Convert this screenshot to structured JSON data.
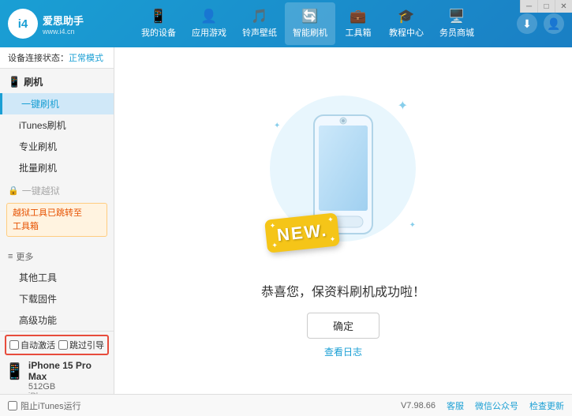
{
  "app": {
    "title": "爱思助手",
    "subtitle": "www.i4.cn"
  },
  "window_controls": {
    "minimize": "─",
    "maximize": "□",
    "close": "✕"
  },
  "nav": {
    "tabs": [
      {
        "id": "my-device",
        "label": "我的设备",
        "icon": "📱"
      },
      {
        "id": "apps-games",
        "label": "应用游戏",
        "icon": "👤"
      },
      {
        "id": "ringtones",
        "label": "铃声壁纸",
        "icon": "🎵"
      },
      {
        "id": "smart-flash",
        "label": "智能刷机",
        "icon": "🔄",
        "active": true
      },
      {
        "id": "toolbox",
        "label": "工具箱",
        "icon": "💼"
      },
      {
        "id": "tutorials",
        "label": "教程中心",
        "icon": "🎓"
      },
      {
        "id": "service",
        "label": "务员商城",
        "icon": "🖥️"
      }
    ]
  },
  "header_right": {
    "download_icon": "⬇",
    "user_icon": "👤"
  },
  "sidebar": {
    "status_label": "设备连接状态：",
    "status_value": "正常模式",
    "flash_section": {
      "label": "刷机",
      "icon": "📱"
    },
    "items": [
      {
        "id": "one-key-flash",
        "label": "一键刷机",
        "active": true
      },
      {
        "id": "itunes-flash",
        "label": "iTunes刷机",
        "active": false
      },
      {
        "id": "pro-flash",
        "label": "专业刷机",
        "active": false
      },
      {
        "id": "batch-flash",
        "label": "批量刷机",
        "active": false
      }
    ],
    "disabled_item": {
      "label": "一键越狱",
      "icon": "🔒"
    },
    "warning_text": "越狱工具已跳转至\n工具箱",
    "more_section": {
      "label": "更多"
    },
    "more_items": [
      {
        "id": "other-tools",
        "label": "其他工具"
      },
      {
        "id": "download-firmware",
        "label": "下载固件"
      },
      {
        "id": "advanced",
        "label": "高级功能"
      }
    ]
  },
  "device": {
    "auto_activate": "自动激活",
    "guide_activate": "跳过引导",
    "name": "iPhone 15 Pro Max",
    "storage": "512GB",
    "type": "iPhone"
  },
  "bottom": {
    "itunes_label": "阻止iTunes运行",
    "version": "V7.98.66",
    "feedback": "客服",
    "wechat": "微信公众号",
    "check_update": "检查更新"
  },
  "content": {
    "success_message": "恭喜您，保资料刷机成功啦！",
    "confirm_button": "确定",
    "log_link": "查看日志",
    "new_badge": "NEW.",
    "sparkle_char": "✦"
  }
}
